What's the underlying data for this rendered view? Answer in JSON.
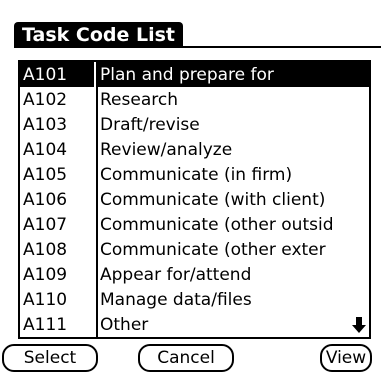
{
  "title": "Task Code List",
  "list": {
    "rows": [
      {
        "code": "A101",
        "desc": "Plan and prepare for",
        "selected": true
      },
      {
        "code": "A102",
        "desc": "Research",
        "selected": false
      },
      {
        "code": "A103",
        "desc": "Draft/revise",
        "selected": false
      },
      {
        "code": "A104",
        "desc": "Review/analyze",
        "selected": false
      },
      {
        "code": "A105",
        "desc": "Communicate (in firm)",
        "selected": false
      },
      {
        "code": "A106",
        "desc": "Communicate (with client)",
        "selected": false
      },
      {
        "code": "A107",
        "desc": "Communicate (other outsid",
        "selected": false
      },
      {
        "code": "A108",
        "desc": "Communicate (other exter",
        "selected": false
      },
      {
        "code": "A109",
        "desc": "Appear for/attend",
        "selected": false
      },
      {
        "code": "A110",
        "desc": "Manage data/files",
        "selected": false
      },
      {
        "code": "A111",
        "desc": "Other",
        "selected": false
      }
    ],
    "scroll_icon": "scroll-down-arrow-icon"
  },
  "buttons": {
    "select": "Select",
    "cancel": "Cancel",
    "view": "View"
  }
}
